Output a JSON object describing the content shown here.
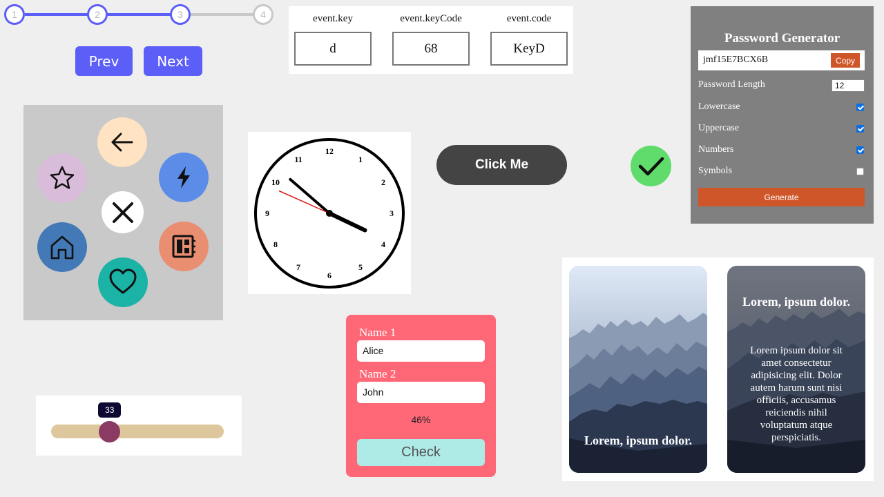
{
  "stepper": {
    "steps": [
      "1",
      "2",
      "3",
      "4"
    ],
    "active_steps": 3,
    "prev_label": "Prev",
    "next_label": "Next"
  },
  "key_event": {
    "columns": [
      {
        "label": "event.key",
        "value": "d"
      },
      {
        "label": "event.keyCode",
        "value": "68"
      },
      {
        "label": "event.code",
        "value": "KeyD"
      }
    ]
  },
  "password_generator": {
    "title": "Password Generator",
    "password": "jmf15E7BCX6B",
    "copy_label": "Copy",
    "length_label": "Password Length",
    "length_value": "12",
    "options": [
      {
        "label": "Lowercase",
        "checked": true
      },
      {
        "label": "Uppercase",
        "checked": true
      },
      {
        "label": "Numbers",
        "checked": true
      },
      {
        "label": "Symbols",
        "checked": false
      }
    ],
    "generate_label": "Generate"
  },
  "circle_menu": {
    "icons": [
      "back-arrow-icon",
      "lightning-icon",
      "star-icon",
      "close-icon",
      "home-icon",
      "dashboard-icon",
      "heart-icon"
    ],
    "colors": {
      "back": "#ffe3c2",
      "lightning": "#5b8de8",
      "star": "#d9bcd9",
      "close": "#ffffff",
      "home": "#4279b6",
      "dashboard": "#ea8e72",
      "heart": "#1ab3a6"
    }
  },
  "clock": {
    "numerals": [
      "12",
      "1",
      "2",
      "3",
      "4",
      "5",
      "6",
      "7",
      "8",
      "9",
      "10",
      "11"
    ],
    "time": {
      "hour": 3,
      "minute": 51,
      "second": 49
    }
  },
  "click_button": {
    "label": "Click Me"
  },
  "check_status": {
    "icon": "checkmark-icon",
    "color": "#5fdc6b"
  },
  "slider": {
    "value": "33",
    "fraction": 0.33
  },
  "names_form": {
    "name1_label": "Name 1",
    "name1_value": "Alice",
    "name2_label": "Name 2",
    "name2_value": "John",
    "result": "46%",
    "check_label": "Check"
  },
  "cards": {
    "card1_title": "Lorem, ipsum dolor.",
    "card2_title": "Lorem, ipsum dolor.",
    "card2_text": "Lorem ipsum dolor sit amet consectetur adipisicing elit. Dolor autem harum sunt nisi officiis, accusamus reiciendis nihil voluptatum atque perspiciatis."
  }
}
